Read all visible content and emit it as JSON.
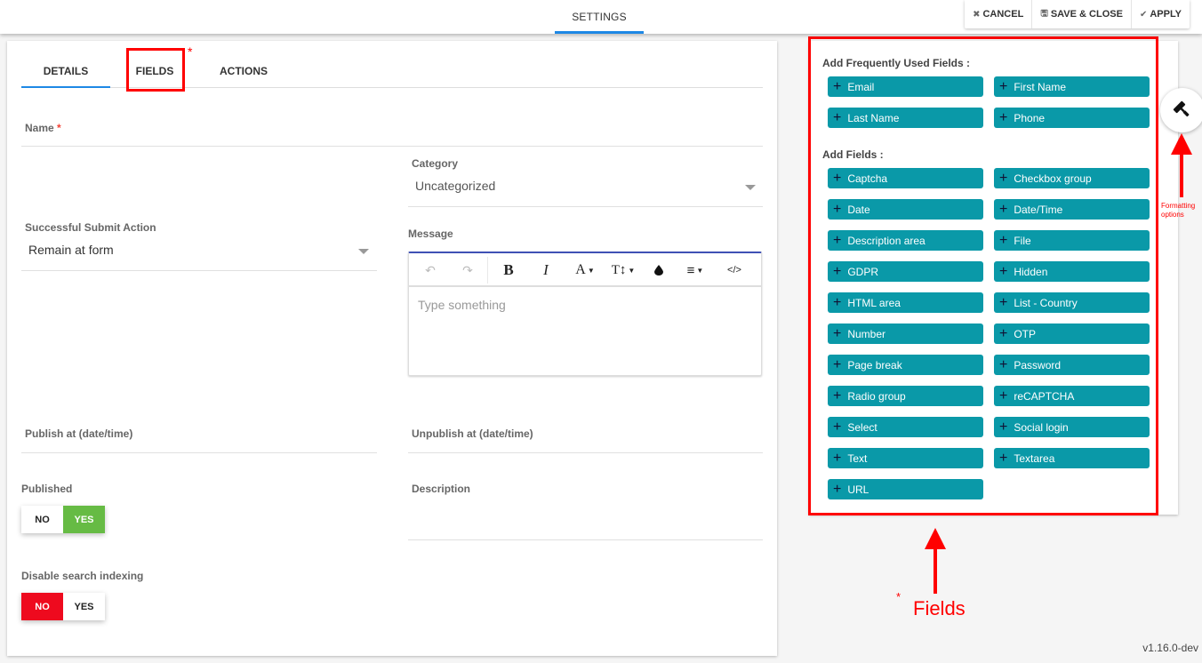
{
  "topbar": {
    "tab": "SETTINGS",
    "cancel": "CANCEL",
    "save_close": "SAVE & CLOSE",
    "apply": "APPLY"
  },
  "tabs": {
    "details": "DETAILS",
    "fields": "FIELDS",
    "actions": "ACTIONS"
  },
  "form": {
    "name_label": "Name",
    "required_mark": "*",
    "category_label": "Category",
    "category_value": "Uncategorized",
    "submit_action_label": "Successful Submit Action",
    "submit_action_value": "Remain at form",
    "message_label": "Message",
    "editor_placeholder": "Type something",
    "publish_label": "Publish at (date/time)",
    "unpublish_label": "Unpublish at (date/time)",
    "published_label": "Published",
    "description_label": "Description",
    "disable_indexing_label": "Disable search indexing",
    "published_toggle": {
      "no": "NO",
      "yes": "YES",
      "selected": "YES"
    },
    "indexing_toggle": {
      "no": "NO",
      "yes": "YES",
      "selected": "NO"
    }
  },
  "editor_toolbar": {
    "undo": "↶",
    "redo": "↷",
    "bold": "B",
    "italic": "I",
    "font_color": "A",
    "font_size": "T↕",
    "highlight": "💧",
    "align": "≡",
    "code": "</>"
  },
  "fields_panel": {
    "frequent_title": "Add Frequently Used Fields :",
    "frequent": [
      "Email",
      "First Name",
      "Last Name",
      "Phone"
    ],
    "all_title": "Add Fields :",
    "all": [
      "Captcha",
      "Checkbox group",
      "Date",
      "Date/Time",
      "Description area",
      "File",
      "GDPR",
      "Hidden",
      "HTML area",
      "List - Country",
      "Number",
      "OTP",
      "Page break",
      "Password",
      "Radio group",
      "reCAPTCHA",
      "Select",
      "Social login",
      "Text",
      "Textarea",
      "URL"
    ]
  },
  "annotations": {
    "star": "*",
    "fields_label": "Fields",
    "formatting_label_1": "Formatting",
    "formatting_label_2": "options"
  },
  "version": "v1.16.0-dev",
  "colors": {
    "accent": "#1e88e5",
    "field_button": "#0a99a8",
    "yes_green": "#66bb44",
    "no_red": "#ee0a1e",
    "annotation": "#ff0000"
  }
}
